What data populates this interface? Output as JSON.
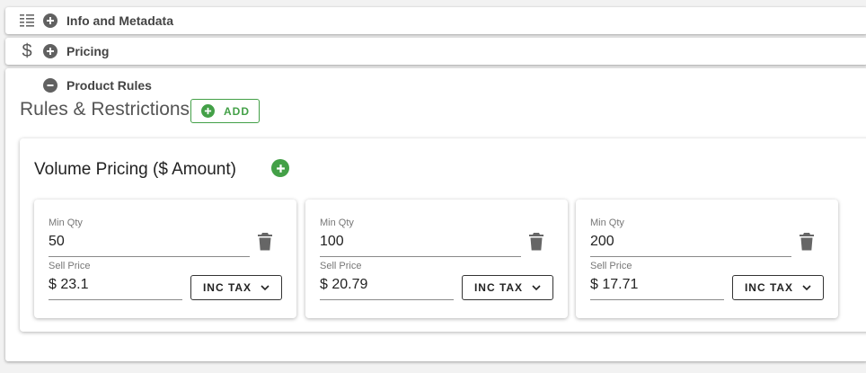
{
  "panels": {
    "info": {
      "title": "Info and Metadata",
      "icon": "list-icon",
      "toggle_icon": "expand-plus-icon"
    },
    "pricing": {
      "title": "Pricing",
      "icon": "dollar-icon",
      "lead_glyph": "$",
      "toggle_icon": "expand-plus-icon"
    },
    "rules": {
      "title": "Product Rules",
      "toggle_icon": "collapse-minus-icon"
    }
  },
  "rules": {
    "section_title": "Rules & Restrictions",
    "add_label": "ADD",
    "volume_pricing": {
      "title": "Volume Pricing ($ Amount)",
      "tiers": [
        {
          "min_qty_label": "Min Qty",
          "min_qty": "50",
          "sell_price_label": "Sell Price",
          "sell_price": "$ 23.1",
          "tax_mode": "INC TAX"
        },
        {
          "min_qty_label": "Min Qty",
          "min_qty": "100",
          "sell_price_label": "Sell Price",
          "sell_price": "$ 20.79",
          "tax_mode": "INC TAX"
        },
        {
          "min_qty_label": "Min Qty",
          "min_qty": "200",
          "sell_price_label": "Sell Price",
          "sell_price": "$ 17.71",
          "tax_mode": "INC TAX"
        }
      ]
    }
  },
  "colors": {
    "accent_green": "#43a047",
    "icon_gray": "#616161",
    "page_background": "#f2f2f2"
  }
}
